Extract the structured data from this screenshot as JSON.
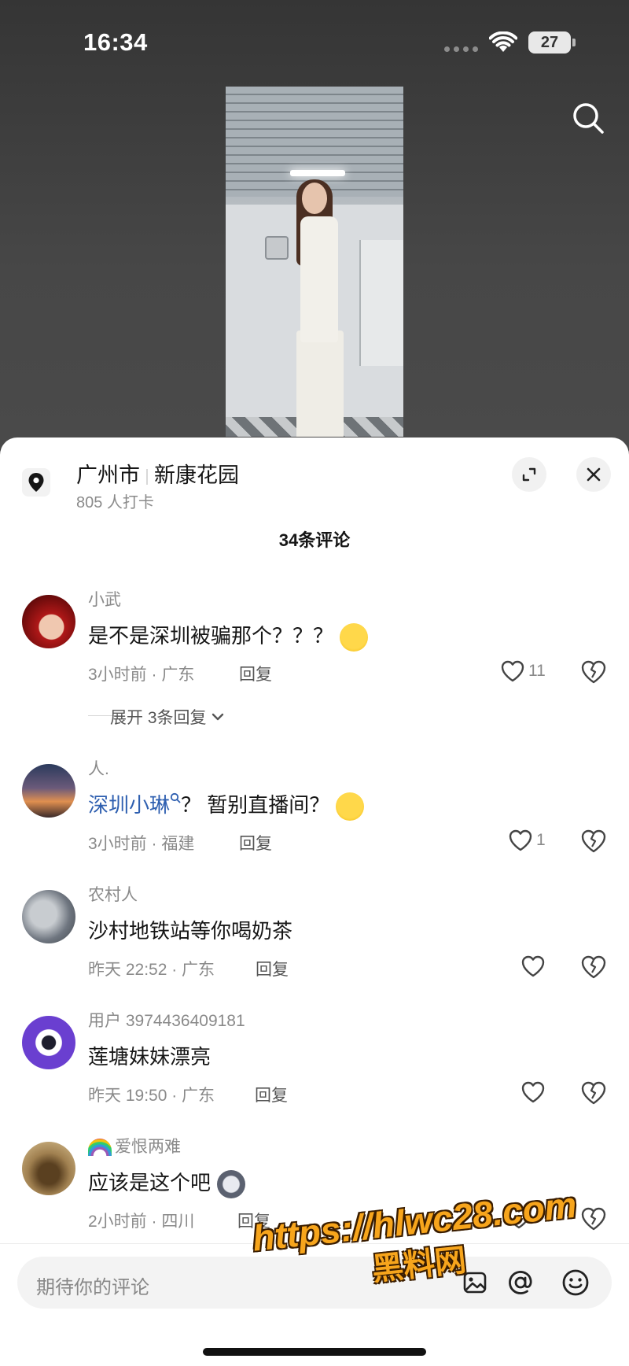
{
  "status_bar": {
    "time": "16:34",
    "battery": "27"
  },
  "location": {
    "city": "广州市",
    "place": "新康花园",
    "checkins": "805 人打卡"
  },
  "comments_header": {
    "count_title": "34条评论"
  },
  "comments": [
    {
      "user": "小武",
      "text": "是不是深圳被骗那个？？？",
      "time_region": "3小时前 · 广东",
      "reply_label": "回复",
      "likes": "11",
      "expand_label": "展开 3条回复"
    },
    {
      "user": "人.",
      "mention": "深圳小琳",
      "text": "？ 暂别直播间？",
      "time_region": "3小时前 · 福建",
      "reply_label": "回复",
      "likes": "1"
    },
    {
      "user": "农村人",
      "text": "沙村地铁站等你喝奶茶",
      "time_region": "昨天 22:52 · 广东",
      "reply_label": "回复",
      "likes": ""
    },
    {
      "user": "用户 3974436409181",
      "text": "莲塘妹妹漂亮",
      "time_region": "昨天 19:50 · 广东",
      "reply_label": "回复",
      "likes": ""
    },
    {
      "user": "爱恨两难",
      "text": "应该是这个吧",
      "time_region": "2小时前 · 四川",
      "reply_label": "回复",
      "likes": ""
    }
  ],
  "input": {
    "placeholder": "期待你的评论"
  },
  "watermark": {
    "line1": "https://hlwc28.com",
    "line2": "黑料网"
  },
  "colors": {
    "accent_mention": "#2e5fb0",
    "watermark": "#f7a51c"
  },
  "icons": [
    "search-icon",
    "location-pin-icon",
    "expand-icon",
    "close-icon",
    "heart-icon",
    "broken-heart-icon",
    "chevron-down-icon",
    "image-icon",
    "at-icon",
    "emoji-icon",
    "wifi-icon",
    "battery-icon"
  ]
}
